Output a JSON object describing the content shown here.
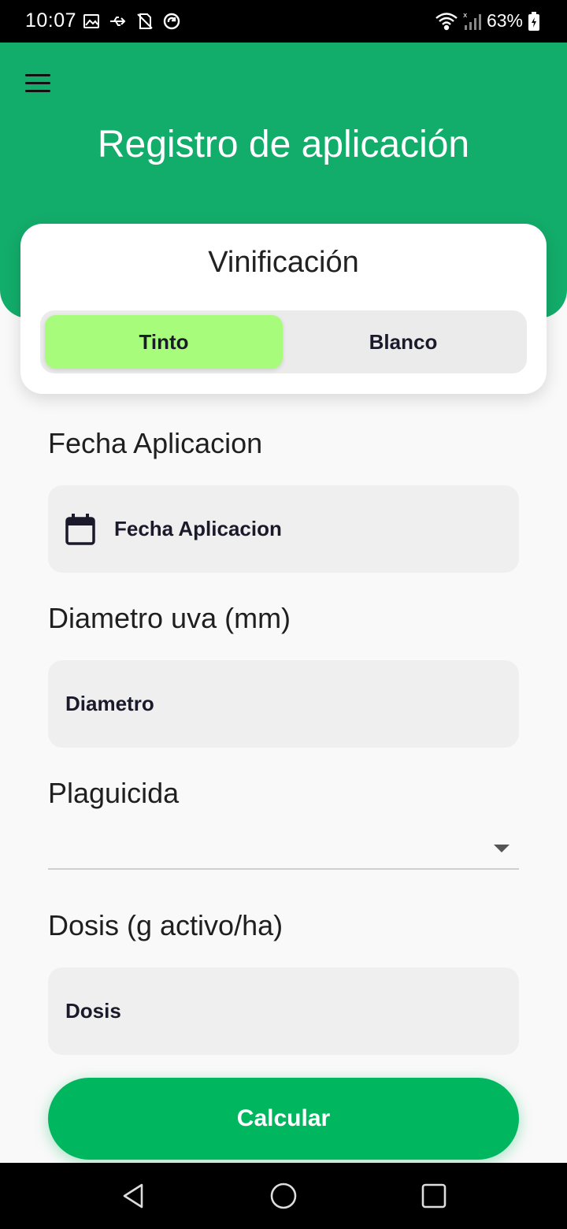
{
  "status_bar": {
    "time": "10:07",
    "battery": "63%",
    "icons_left": [
      "gallery-icon",
      "usb-icon",
      "no-sim-icon",
      "sync-icon"
    ],
    "icons_right": [
      "wifi-icon",
      "signal-icon",
      "battery-icon"
    ]
  },
  "header": {
    "title": "Registro de aplicación",
    "background_color": "#13ad6b"
  },
  "vinification": {
    "title": "Vinificación",
    "options": [
      "Tinto",
      "Blanco"
    ],
    "selected": "Tinto",
    "selected_color": "#a8fc7c"
  },
  "form": {
    "fecha": {
      "label": "Fecha Aplicacion",
      "placeholder": "Fecha Aplicacion"
    },
    "diametro": {
      "label": "Diametro uva (mm)",
      "placeholder": "Diametro"
    },
    "plaguicida": {
      "label": "Plaguicida",
      "value": ""
    },
    "dosis": {
      "label": "Dosis (g activo/ha)",
      "placeholder": "Dosis"
    }
  },
  "actions": {
    "calcular_label": "Calcular",
    "button_color": "#00b760"
  },
  "nav_bar": {
    "buttons": [
      "back-icon",
      "home-icon",
      "recents-icon"
    ]
  }
}
